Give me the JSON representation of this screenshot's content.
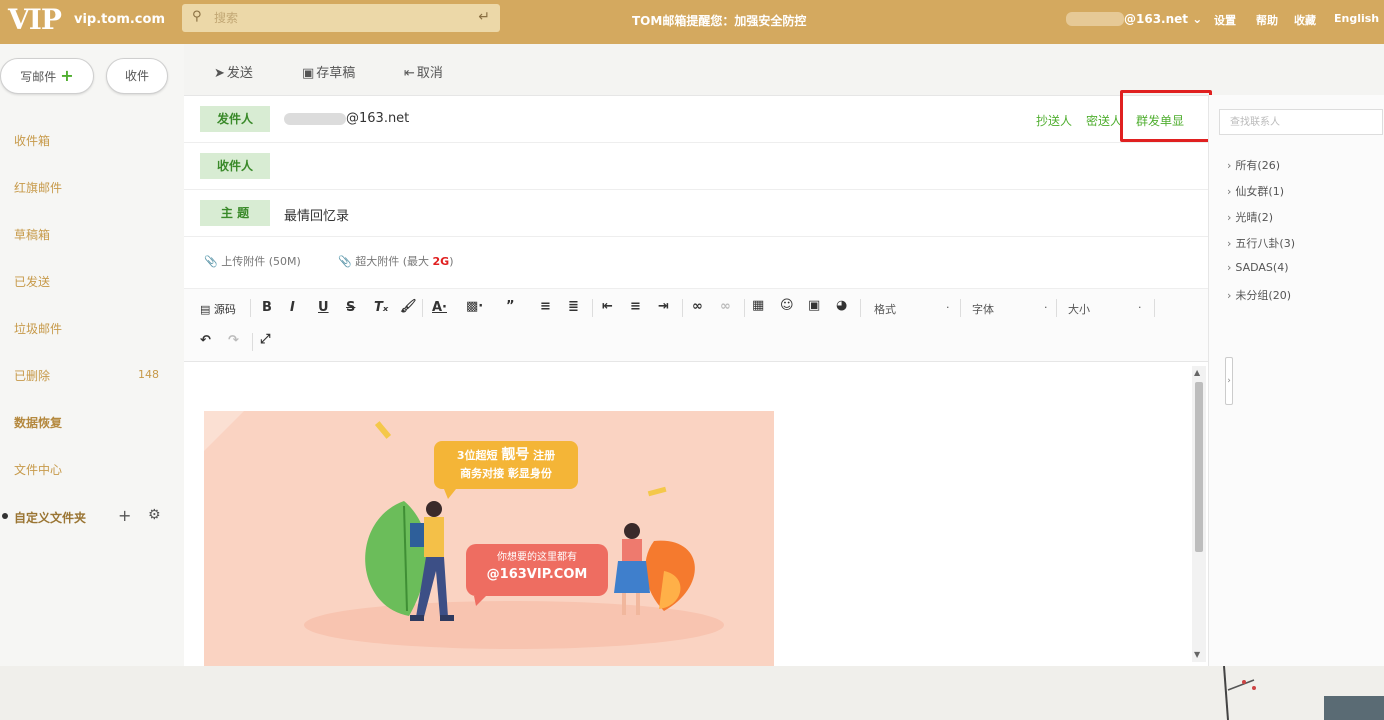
{
  "header": {
    "logo_text": "VIP",
    "logo_url": "vip.tom.com",
    "search_placeholder": "搜索",
    "notice": "TOM邮箱提醒您：加强安全防控",
    "account": "@163.net",
    "nav": [
      "设置",
      "帮助",
      "收藏",
      "English"
    ]
  },
  "sidebar": {
    "compose_label": "写邮件",
    "receive_label": "收件",
    "folders": [
      {
        "label": "收件箱",
        "count": ""
      },
      {
        "label": "红旗邮件",
        "count": ""
      },
      {
        "label": "草稿箱",
        "count": ""
      },
      {
        "label": "已发送",
        "count": ""
      },
      {
        "label": "垃圾邮件",
        "count": ""
      },
      {
        "label": "已删除",
        "count": "148"
      },
      {
        "label": "数据恢复",
        "count": ""
      },
      {
        "label": "文件中心",
        "count": ""
      }
    ],
    "custom_folder": "自定义文件夹"
  },
  "toolbar": {
    "send_label": "发送",
    "draft_label": "存草稿",
    "cancel_label": "取消"
  },
  "compose": {
    "from_tag": "发件人",
    "from_value": "@163.net",
    "to_tag": "收件人",
    "subject_tag": "主 题",
    "subject_value": "最情回忆录",
    "cc_label": "抄送人",
    "bcc_label": "密送人",
    "mass_label": "群发单显",
    "upload_label": "上传附件 (50M)",
    "big_attach_label": "超大附件 (最大 ",
    "big_attach_size": "2G",
    "big_attach_close": ")"
  },
  "editor": {
    "source_label": "源码",
    "format_label": "格式",
    "font_label": "字体",
    "size_label": "大小"
  },
  "banner": {
    "bubble1_line1_a": "3位超短",
    "bubble1_line1_b": "靓号",
    "bubble1_line1_c": "注册",
    "bubble1_line2": "商务对接  彰显身份",
    "bubble2_line1": "你想要的这里都有",
    "bubble2_line2": "@163VIP.COM"
  },
  "contacts": {
    "search_placeholder": "查找联系人",
    "groups": [
      "所有(26)",
      "仙女群(1)",
      "光晴(2)",
      "五行八卦(3)",
      "SADAS(4)",
      "未分组(20)"
    ]
  },
  "colors": {
    "topbar": "#d4a95f",
    "accent_green": "#4fae2f",
    "highlight_red": "#e02020"
  }
}
